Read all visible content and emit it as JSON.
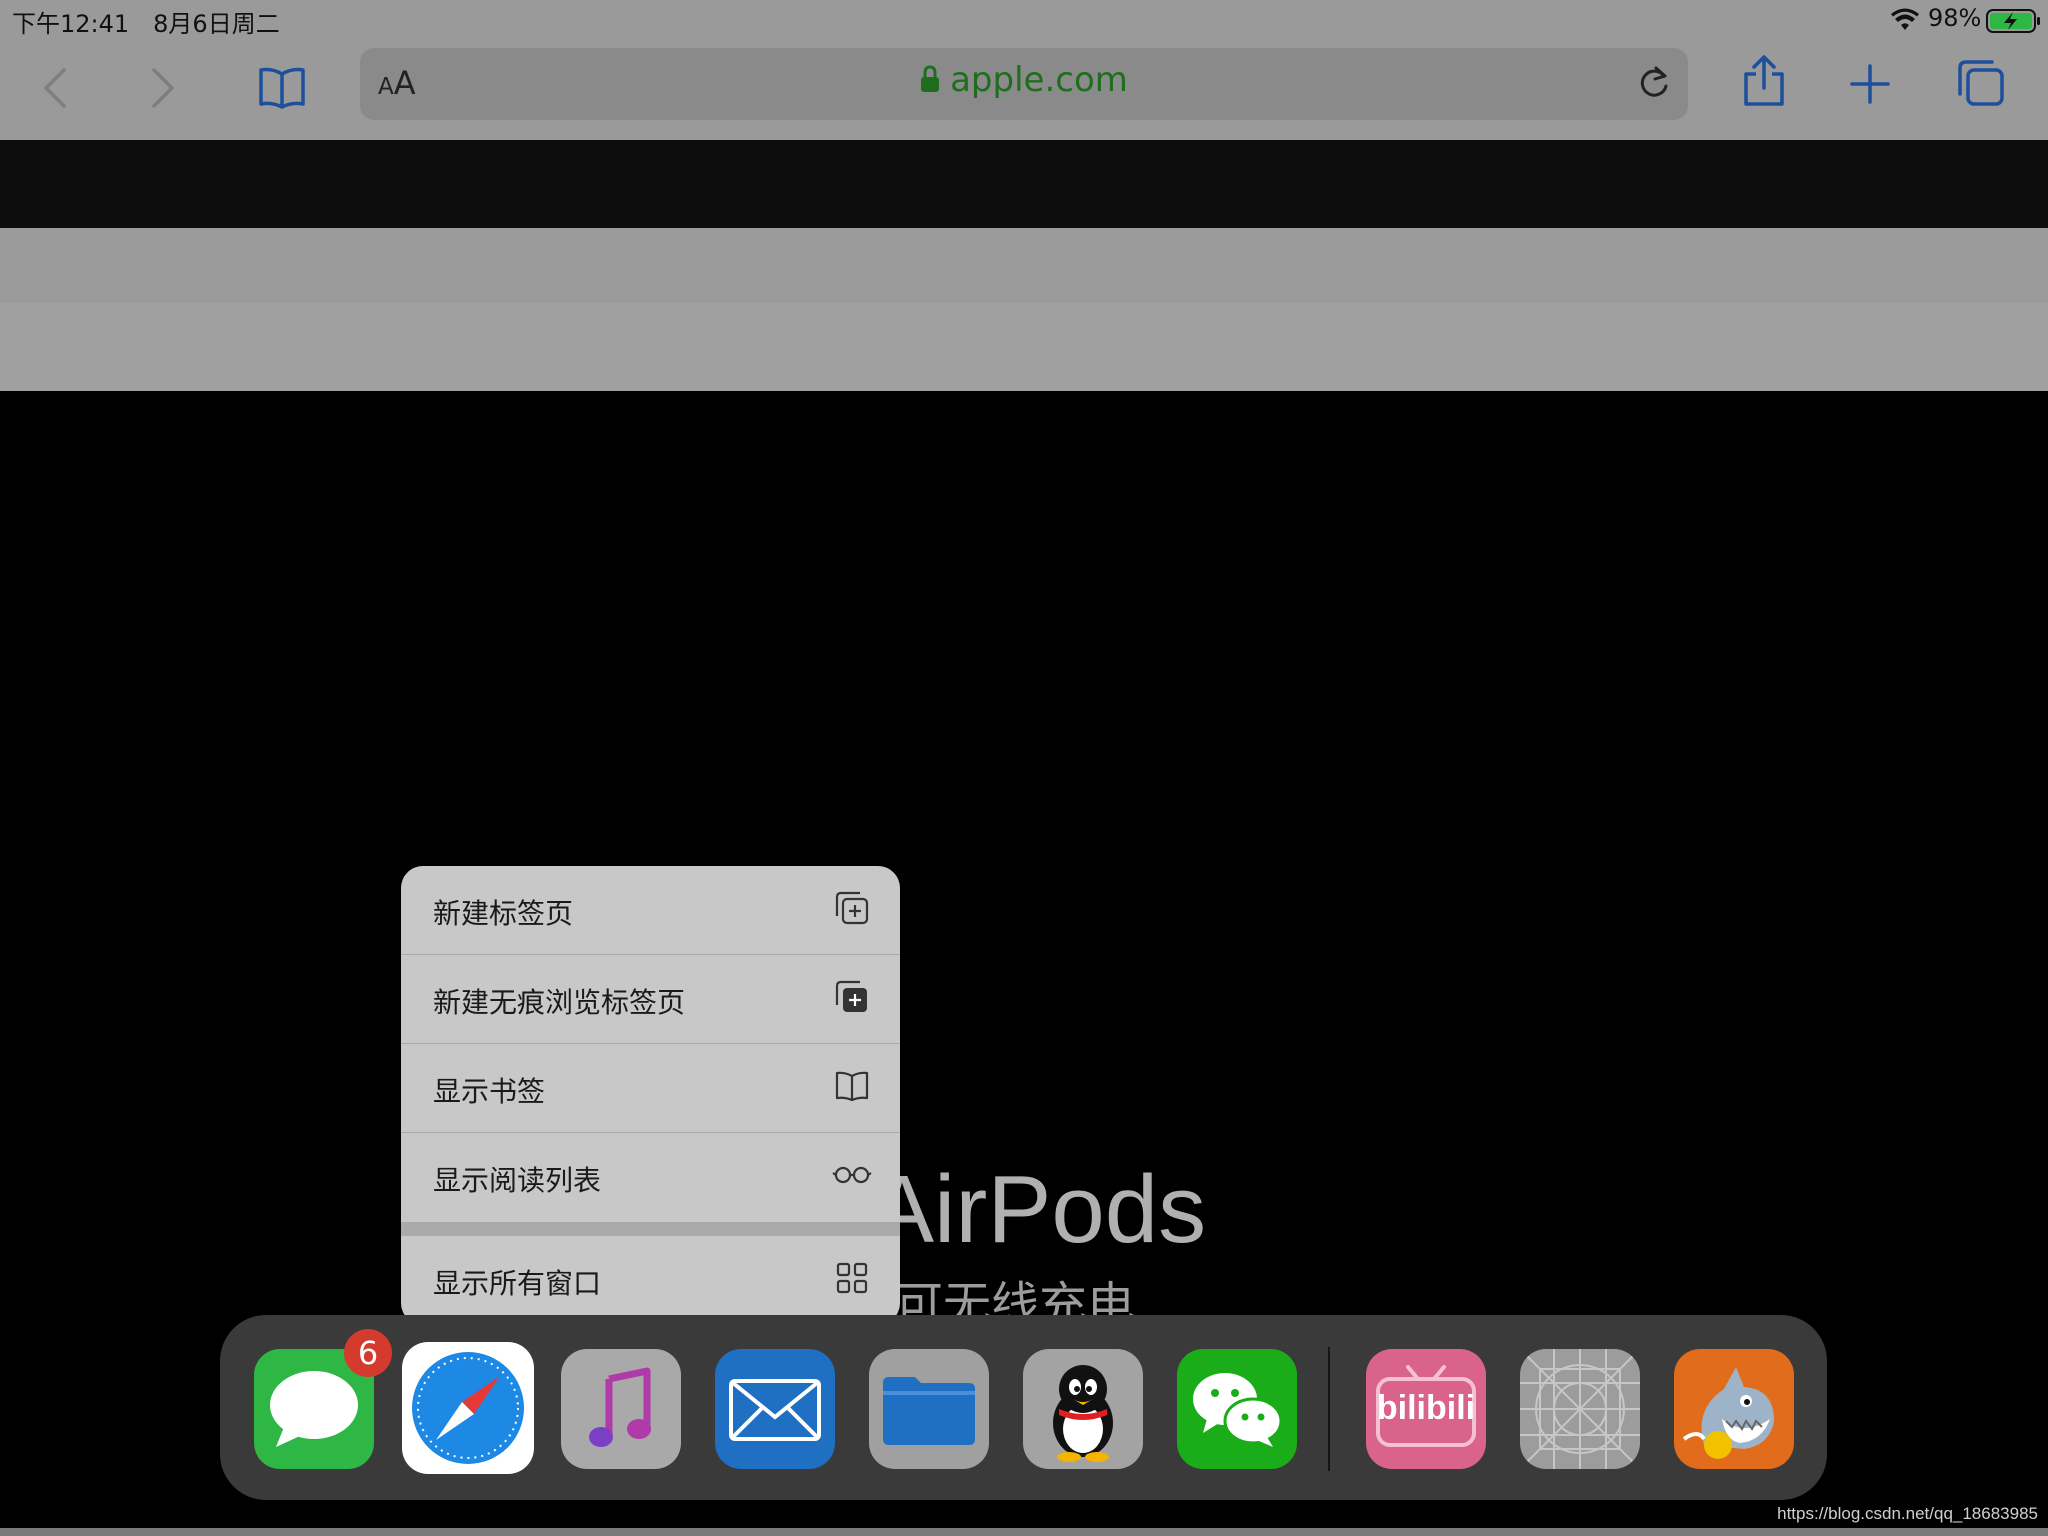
{
  "status_bar": {
    "time_date": "下午12:41　8月6日周二",
    "battery": "98%",
    "icons": [
      "wifi-icon",
      "battery-charging-icon"
    ]
  },
  "toolbar": {
    "icons": [
      "back-icon",
      "forward-icon",
      "bookmarks-icon",
      "share-icon",
      "new-tab-plus-icon",
      "tabs-icon"
    ],
    "reader_button": {
      "small": "A",
      "large": "A"
    },
    "url": "apple.com",
    "accent_color": "#1d4f9c",
    "url_color": "#1f6e1f"
  },
  "page": {
    "hero_title": "AirPods",
    "hero_subtitle": "可无线充电"
  },
  "context_menu": {
    "items": [
      {
        "label": "新建标签页",
        "icon": "new-tab-icon"
      },
      {
        "label": "新建无痕浏览标签页",
        "icon": "new-private-tab-icon"
      },
      {
        "label": "显示书签",
        "icon": "book-icon"
      },
      {
        "label": "显示阅读列表",
        "icon": "glasses-icon"
      },
      {
        "label": "显示所有窗口",
        "icon": "grid-icon"
      }
    ]
  },
  "dock": {
    "apps": [
      {
        "name": "messages",
        "badge": "6",
        "color": "#2fb745"
      },
      {
        "name": "safari",
        "color": "#1e88e5"
      },
      {
        "name": "music",
        "color": "#a9a9a9"
      },
      {
        "name": "mail",
        "color": "#1f6fc2"
      },
      {
        "name": "files",
        "color": "#a0a0a0"
      },
      {
        "name": "qq",
        "color": "#a3a3a3"
      },
      {
        "name": "wechat",
        "color": "#1aad19"
      },
      {
        "name": "bilibili",
        "label": "bilibili",
        "color": "#d9638b"
      },
      {
        "name": "placeholder-app",
        "color": "#9c9c9c"
      },
      {
        "name": "shark-game",
        "color": "#e06c1c"
      }
    ]
  },
  "watermark": "https://blog.csdn.net/qq_18683985"
}
